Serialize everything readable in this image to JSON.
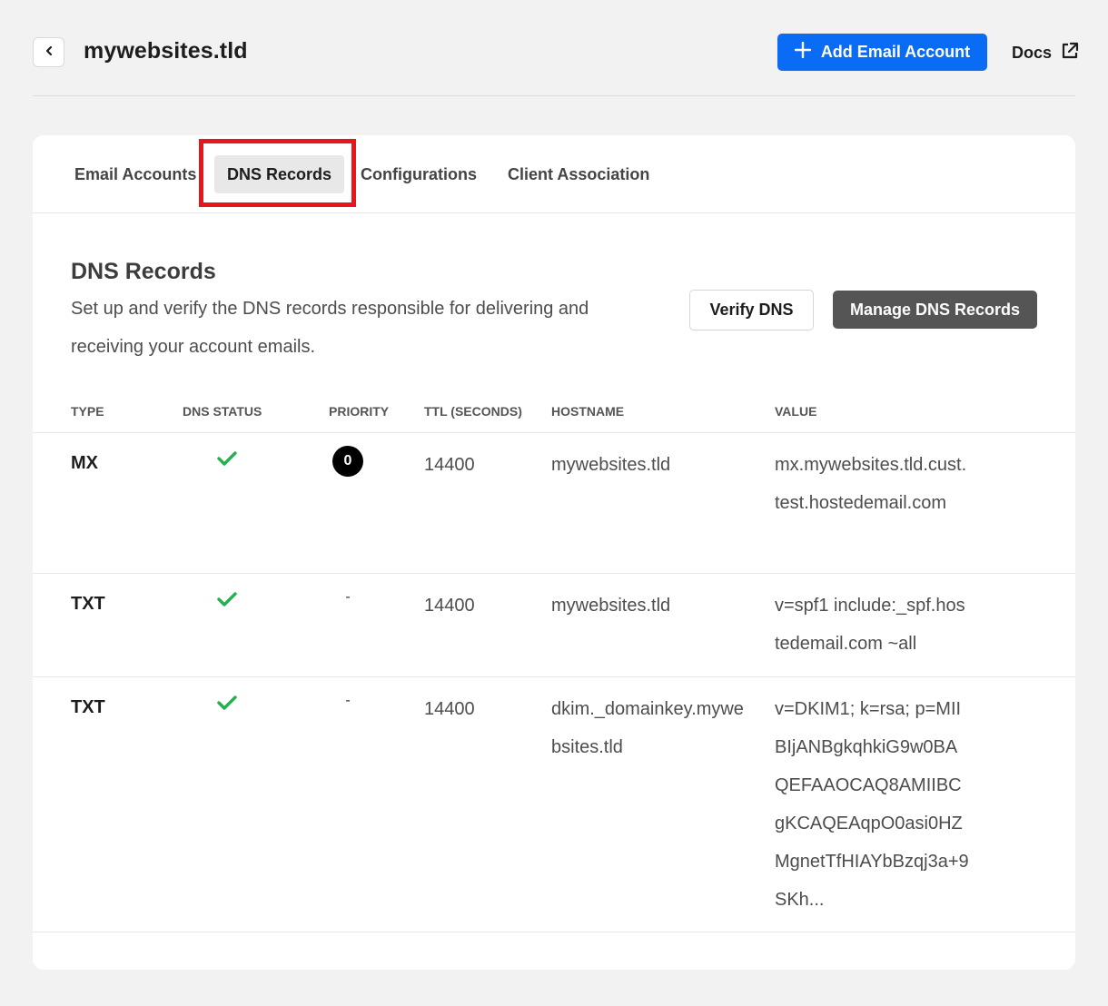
{
  "header": {
    "title": "mywebsites.tld",
    "add_button_label": "Add Email Account",
    "docs_label": "Docs"
  },
  "tabs": [
    {
      "label": "Email Accounts",
      "active": false
    },
    {
      "label": "DNS Records",
      "active": true
    },
    {
      "label": "Configurations",
      "active": false
    },
    {
      "label": "Client Association",
      "active": false
    }
  ],
  "section": {
    "title": "DNS Records",
    "description": "Set up and verify the DNS records responsible for delivering and receiving your account emails.",
    "verify_label": "Verify DNS",
    "manage_label": "Manage DNS Records"
  },
  "table": {
    "headers": {
      "type": "TYPE",
      "status": "DNS STATUS",
      "priority": "PRIORITY",
      "ttl": "TTL (SECONDS)",
      "hostname": "HOSTNAME",
      "value": "VALUE"
    },
    "rows": [
      {
        "type": "MX",
        "status": "verified",
        "priority": "0",
        "ttl": "14400",
        "hostname": "mywebsites.tld",
        "value": "mx.mywebsites.tld.cust.test.hostedemail.com"
      },
      {
        "type": "TXT",
        "status": "verified",
        "priority": "-",
        "ttl": "14400",
        "hostname": "mywebsites.tld",
        "value": "v=spf1 include:_spf.hostedemail.com ~all"
      },
      {
        "type": "TXT",
        "status": "verified",
        "priority": "-",
        "ttl": "14400",
        "hostname": "dkim._domainkey.mywebsites.tld",
        "value": "v=DKIM1; k=rsa; p=MIIBIjANBgkqhkiG9w0BAQEFAAOCAQ8AMIIBCgKCAQEAqpO0asi0HZMgnetTfHIAYbBzqj3a+9SKh..."
      }
    ]
  },
  "icons": {
    "back": "chevron-left-icon",
    "add": "plus-icon",
    "docs": "external-link-icon",
    "status": "check-icon"
  },
  "colors": {
    "primary": "#0a6cf5",
    "highlight": "#e8161c",
    "success": "#22b14c",
    "manage_button": "#555555"
  }
}
